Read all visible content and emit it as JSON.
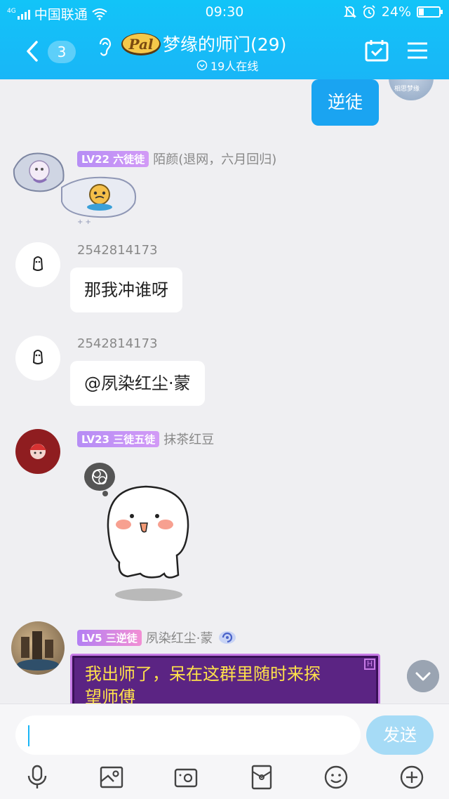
{
  "status": {
    "carrier": "中国联通",
    "time": "09:30",
    "battery": "24%",
    "battery_level": 0.24
  },
  "header": {
    "unread_count": "3",
    "group_name": "梦缘的师门(29)",
    "online": "19人在线"
  },
  "messages": [
    {
      "sender": "me",
      "text": "逆徒"
    },
    {
      "level": "LV22",
      "title": "六徒徒",
      "name": "陌颜(退网，六月回归)",
      "type": "sticker"
    },
    {
      "name": "2542814173",
      "text": "那我冲谁呀"
    },
    {
      "name": "2542814173",
      "text": "@夙染红尘·蒙"
    },
    {
      "level": "LV23",
      "title": "三徒五徒",
      "name": "抹茶红豆",
      "type": "sticker"
    },
    {
      "level": "LV5",
      "title": "三逆徒",
      "name": "夙染红尘·蒙",
      "text_line1": "我出师了，呆在这群里随时来探",
      "text_line2": "望师傅"
    }
  ],
  "composer": {
    "placeholder": "",
    "send_label": "发送"
  },
  "colors": {
    "header": "#19b6f7",
    "my_bubble": "#1aa4f1",
    "send_disabled": "#a6dbf6"
  }
}
